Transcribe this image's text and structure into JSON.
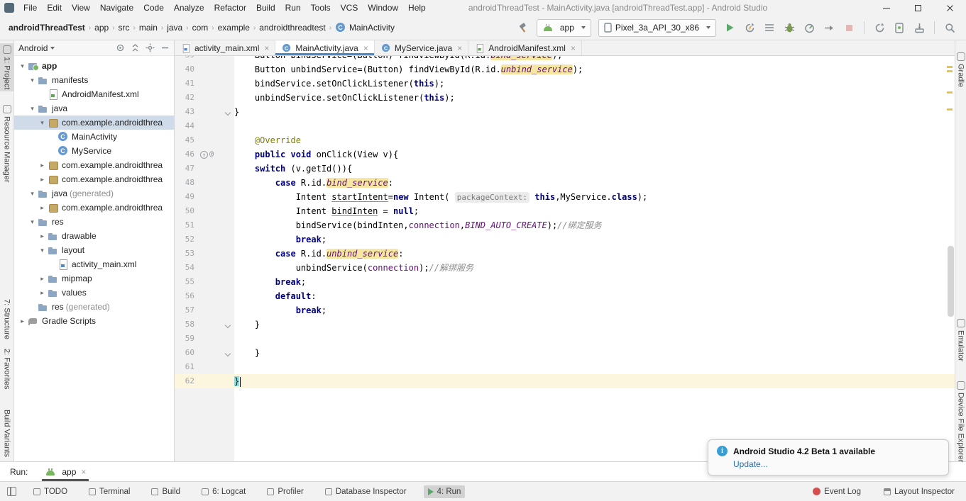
{
  "window": {
    "title": "androidThreadTest - MainActivity.java [androidThreadTest.app] - Android Studio",
    "menus": [
      "File",
      "Edit",
      "View",
      "Navigate",
      "Code",
      "Analyze",
      "Refactor",
      "Build",
      "Run",
      "Tools",
      "VCS",
      "Window",
      "Help"
    ]
  },
  "toolbar": {
    "breadcrumbs": [
      "androidThreadTest",
      "app",
      "src",
      "main",
      "java",
      "com",
      "example",
      "androidthreadtest",
      "MainActivity"
    ],
    "run_config": "app",
    "device": "Pixel_3a_API_30_x86",
    "icons": [
      "hammer",
      "run",
      "apply-changes",
      "run-configurations",
      "debug",
      "profile",
      "attach-debugger",
      "stop",
      "sync-gradle",
      "avd-manager",
      "sdk-manager",
      "search-everywhere"
    ]
  },
  "left_stripe": {
    "items": [
      {
        "label": "1: Project",
        "active": true
      },
      {
        "label": "Resource Manager"
      },
      {
        "label": "7: Structure"
      },
      {
        "label": "2: Favorites"
      },
      {
        "label": "Build Variants"
      }
    ]
  },
  "right_stripe": {
    "items": [
      {
        "label": "Gradle"
      },
      {
        "label": "Emulator"
      },
      {
        "label": "Device File Explorer"
      }
    ]
  },
  "project": {
    "mode": "Android",
    "tree": [
      {
        "label": "app",
        "icon": "module",
        "indent": 0,
        "arrow": "open",
        "bold": true
      },
      {
        "label": "manifests",
        "icon": "folder",
        "indent": 1,
        "arrow": "open"
      },
      {
        "label": "AndroidManifest.xml",
        "icon": "manifest-file",
        "indent": 2,
        "arrow": "none"
      },
      {
        "label": "java",
        "icon": "folder",
        "indent": 1,
        "arrow": "open"
      },
      {
        "label": "com.example.androidthrea",
        "icon": "package",
        "indent": 2,
        "arrow": "open",
        "selected": true
      },
      {
        "label": "MainActivity",
        "icon": "class",
        "indent": 3,
        "arrow": "none"
      },
      {
        "label": "MyService",
        "icon": "class",
        "indent": 3,
        "arrow": "none"
      },
      {
        "label": "com.example.androidthrea",
        "icon": "package",
        "indent": 2,
        "arrow": "closed"
      },
      {
        "label": "com.example.androidthrea",
        "icon": "package",
        "indent": 2,
        "arrow": "closed"
      },
      {
        "label": "java",
        "suffix": "(generated)",
        "icon": "folder",
        "indent": 1,
        "arrow": "open"
      },
      {
        "label": "com.example.androidthrea",
        "icon": "package",
        "indent": 2,
        "arrow": "closed"
      },
      {
        "label": "res",
        "icon": "folder",
        "indent": 1,
        "arrow": "open"
      },
      {
        "label": "drawable",
        "icon": "folder",
        "indent": 2,
        "arrow": "closed"
      },
      {
        "label": "layout",
        "icon": "folder",
        "indent": 2,
        "arrow": "open"
      },
      {
        "label": "activity_main.xml",
        "icon": "layout-file",
        "indent": 3,
        "arrow": "none"
      },
      {
        "label": "mipmap",
        "icon": "folder",
        "indent": 2,
        "arrow": "closed"
      },
      {
        "label": "values",
        "icon": "folder",
        "indent": 2,
        "arrow": "closed"
      },
      {
        "label": "res",
        "suffix": "(generated)",
        "icon": "folder",
        "indent": 1,
        "arrow": "none"
      },
      {
        "label": "Gradle Scripts",
        "icon": "gradle",
        "indent": 0,
        "arrow": "closed"
      }
    ]
  },
  "editor": {
    "tabs": [
      {
        "label": "activity_main.xml",
        "icon": "layout-file"
      },
      {
        "label": "MainActivity.java",
        "icon": "class",
        "active": true
      },
      {
        "label": "MyService.java",
        "icon": "class"
      },
      {
        "label": "AndroidManifest.xml",
        "icon": "manifest-file"
      }
    ],
    "lines": [
      {
        "n": 39,
        "ind": 4,
        "t": [
          [
            "Button bindService=(Button) findViewById(R.id.",
            "p"
          ],
          [
            "bind_service",
            "fh"
          ],
          [
            ");",
            "p"
          ]
        ]
      },
      {
        "n": 40,
        "ind": 4,
        "t": [
          [
            "Button unbindService=(Button) findViewById(R.id.",
            "p"
          ],
          [
            "unbind_service",
            "fh"
          ],
          [
            ");",
            "p"
          ]
        ]
      },
      {
        "n": 41,
        "ind": 4,
        "t": [
          [
            "bindService.setOnClickListener(",
            "p"
          ],
          [
            "this",
            "k"
          ],
          [
            ");",
            "p"
          ]
        ]
      },
      {
        "n": 42,
        "ind": 4,
        "t": [
          [
            "unbindService.setOnClickListener(",
            "p"
          ],
          [
            "this",
            "k"
          ],
          [
            ");",
            "p"
          ]
        ]
      },
      {
        "n": 43,
        "ind": 0,
        "fold": true,
        "t": [
          [
            "}",
            "p"
          ]
        ]
      },
      {
        "n": 44,
        "ind": 0,
        "t": []
      },
      {
        "n": 45,
        "ind": 4,
        "t": [
          [
            "@Override",
            "a"
          ]
        ]
      },
      {
        "n": 46,
        "ind": 4,
        "ovr": true,
        "t": [
          [
            "public",
            "k"
          ],
          [
            " ",
            "p"
          ],
          [
            "void",
            "k"
          ],
          [
            " onClick(View v){",
            "p"
          ]
        ]
      },
      {
        "n": 47,
        "ind": 4,
        "t": [
          [
            "switch",
            "k"
          ],
          [
            " (v.getId()){",
            "p"
          ]
        ]
      },
      {
        "n": 48,
        "ind": 8,
        "t": [
          [
            "case",
            "k"
          ],
          [
            " R.id.",
            "p"
          ],
          [
            "bind_service",
            "fh"
          ],
          [
            ":",
            "p"
          ]
        ]
      },
      {
        "n": 49,
        "ind": 12,
        "t": [
          [
            "Intent ",
            "p"
          ],
          [
            "startIntent",
            "u"
          ],
          [
            "=",
            "p"
          ],
          [
            "new",
            "k"
          ],
          [
            " Intent( ",
            "p"
          ],
          [
            "packageContext:",
            "hint"
          ],
          [
            " ",
            "p"
          ],
          [
            "this",
            "k"
          ],
          [
            ",MyService.",
            "p"
          ],
          [
            "class",
            "k"
          ],
          [
            ");",
            "p"
          ]
        ]
      },
      {
        "n": 50,
        "ind": 12,
        "t": [
          [
            "Intent ",
            "p"
          ],
          [
            "bindInten",
            "u"
          ],
          [
            " = ",
            "p"
          ],
          [
            "null",
            "k"
          ],
          [
            ";",
            "p"
          ]
        ]
      },
      {
        "n": 51,
        "ind": 12,
        "t": [
          [
            "bindService(bindInten,",
            "p"
          ],
          [
            "connection",
            "f"
          ],
          [
            ",",
            "p"
          ],
          [
            "BIND_AUTO_CREATE",
            "fi"
          ],
          [
            ");",
            "p"
          ],
          [
            "//绑定服务",
            "c"
          ]
        ]
      },
      {
        "n": 52,
        "ind": 12,
        "t": [
          [
            "break",
            "k"
          ],
          [
            ";",
            "p"
          ]
        ]
      },
      {
        "n": 53,
        "ind": 8,
        "t": [
          [
            "case",
            "k"
          ],
          [
            " R.id.",
            "p"
          ],
          [
            "unbind_service",
            "fh"
          ],
          [
            ":",
            "p"
          ]
        ]
      },
      {
        "n": 54,
        "ind": 12,
        "t": [
          [
            "unbindService(",
            "p"
          ],
          [
            "connection",
            "f"
          ],
          [
            ");",
            "p"
          ],
          [
            "//解绑服务",
            "c"
          ]
        ]
      },
      {
        "n": 55,
        "ind": 8,
        "t": [
          [
            "break",
            "k"
          ],
          [
            ";",
            "p"
          ]
        ]
      },
      {
        "n": 56,
        "ind": 8,
        "t": [
          [
            "default",
            "k"
          ],
          [
            ":",
            "p"
          ]
        ]
      },
      {
        "n": 57,
        "ind": 12,
        "t": [
          [
            "break",
            "k"
          ],
          [
            ";",
            "p"
          ]
        ]
      },
      {
        "n": 58,
        "ind": 4,
        "fold": true,
        "t": [
          [
            "}",
            "p"
          ]
        ]
      },
      {
        "n": 59,
        "ind": 0,
        "t": []
      },
      {
        "n": 60,
        "ind": 4,
        "fold": true,
        "t": [
          [
            "}",
            "p"
          ]
        ]
      },
      {
        "n": 61,
        "ind": 0,
        "t": []
      },
      {
        "n": 62,
        "ind": 0,
        "caret": true,
        "t": [
          [
            "}",
            "brace"
          ]
        ]
      }
    ]
  },
  "run_panel": {
    "label": "Run:",
    "tab_label": "app"
  },
  "status_bar": {
    "left": [
      {
        "label": "TODO"
      },
      {
        "label": "Terminal"
      },
      {
        "label": "Build"
      },
      {
        "label": "6: Logcat"
      },
      {
        "label": "Profiler"
      },
      {
        "label": "Database Inspector"
      },
      {
        "label": "4: Run",
        "active": true,
        "icon": "run"
      }
    ],
    "right": [
      {
        "label": "Event Log",
        "icon": "event"
      },
      {
        "label": "Layout Inspector",
        "icon": "layout"
      }
    ]
  },
  "notification": {
    "title": "Android Studio 4.2 Beta 1 available",
    "link": "Update...",
    "icon": "info-icon"
  },
  "colors": {
    "accent_blue": "#4a88c7",
    "run_green": "#59a869",
    "keyword": "#000080",
    "field_purple": "#660e7a",
    "usage_highlight": "#f5e6a3",
    "caret_line": "#fcf6de",
    "brace_match": "#93d9d9",
    "event_log_red": "#d64f4f",
    "info_blue": "#389fd6"
  }
}
